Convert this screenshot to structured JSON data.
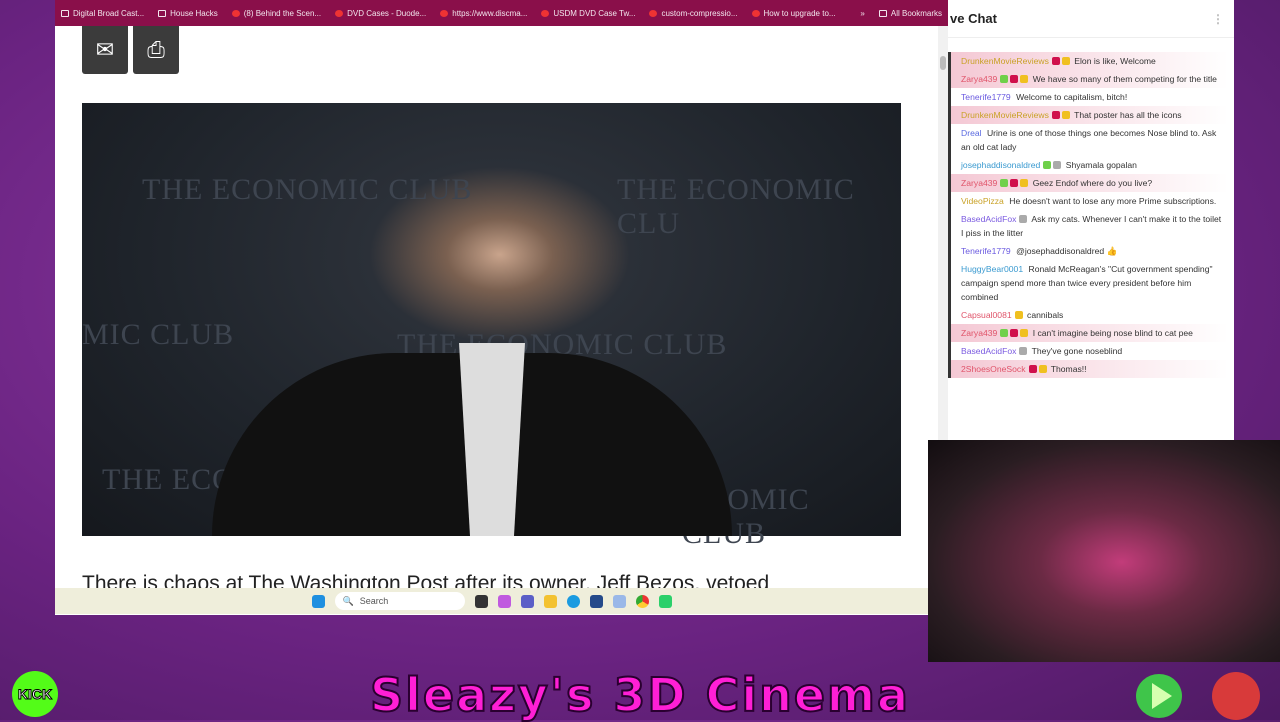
{
  "bookmarks": [
    {
      "label": "Digital Broad Cast...",
      "icon": "folder-icon"
    },
    {
      "label": "House Hacks",
      "icon": "folder-icon"
    },
    {
      "label": "(8) Behind the Scen...",
      "icon": "youtube-icon"
    },
    {
      "label": "DVD Cases - Duode...",
      "icon": "site-icon"
    },
    {
      "label": "https://www.discma...",
      "icon": "site-icon"
    },
    {
      "label": "USDM DVD Case Tw...",
      "icon": "site-icon"
    },
    {
      "label": "custom-compressio...",
      "icon": "wordpress-icon"
    },
    {
      "label": "How to upgrade to...",
      "icon": "apple-icon"
    }
  ],
  "bookmarks_more": "»",
  "all_bookmarks": "All Bookmarks",
  "article": {
    "share": {
      "email_icon": "✉",
      "print_icon": "⎙"
    },
    "photo_text": [
      "THE ECONOMIC CLUB",
      "THE ECONOMIC CLU",
      "MIC CLUB",
      "THE ECONOMIC CLUB",
      "THE ECO",
      "ONOMIC CLUB"
    ],
    "headline": "There is chaos at The Washington Post after its owner, Jeff Bezos, vetoed"
  },
  "taskbar": {
    "search_placeholder": "Search"
  },
  "chat": {
    "title": "ve Chat",
    "menu_icon": "⋮",
    "messages": [
      {
        "user": "DrunkenMovieReviews",
        "color": "#c9a227",
        "text": "Elon is like, Welcome",
        "hl": true,
        "badges": [
          "#d0104c",
          "#f0c020"
        ]
      },
      {
        "user": "Zarya439",
        "color": "#e0546a",
        "text": "We have so many of them competing for the title",
        "hl": true,
        "badges": [
          "#6fd04a",
          "#d0104c",
          "#f0c020"
        ]
      },
      {
        "user": "Tenerife1779",
        "color": "#6a5ae0",
        "text": "Welcome to capitalism, bitch!",
        "hl": false,
        "badges": []
      },
      {
        "user": "DrunkenMovieReviews",
        "color": "#c9a227",
        "text": "That poster has all the icons",
        "hl": true,
        "badges": [
          "#d0104c",
          "#f0c020"
        ]
      },
      {
        "user": "Dreal",
        "color": "#5a6ae0",
        "text": "Urine is one of those things one becomes Nose blind to. Ask an old cat lady",
        "hl": false,
        "badges": []
      },
      {
        "user": "josephaddisonaldred",
        "color": "#3a9ad0",
        "text": "Shyamala gopalan",
        "hl": false,
        "badges": [
          "#6fd04a",
          "#aaaaaa"
        ]
      },
      {
        "user": "Zarya439",
        "color": "#e0546a",
        "text": "Geez Endof where do you live?",
        "hl": true,
        "badges": [
          "#6fd04a",
          "#d0104c",
          "#f0c020"
        ]
      },
      {
        "user": "VideoPizza",
        "color": "#c9a227",
        "text": "He doesn't want to lose any more Prime subscriptions.",
        "hl": false,
        "badges": []
      },
      {
        "user": "BasedAcidFox",
        "color": "#7a5ae0",
        "text": "Ask my cats. Whenever I can't make it to the toilet I piss in the litter",
        "hl": false,
        "badges": [
          "#aaaaaa"
        ]
      },
      {
        "user": "Tenerife1779",
        "color": "#6a5ae0",
        "text": "@josephaddisonaldred 👍",
        "hl": false,
        "badges": []
      },
      {
        "user": "HuggyBear0001",
        "color": "#3a9ad0",
        "text": "Ronald McReagan's \"Cut government spending\" campaign spend more than twice every president before him combined",
        "hl": false,
        "badges": []
      },
      {
        "user": "Capsual0081",
        "color": "#e0546a",
        "text": "cannibals",
        "hl": false,
        "badges": [
          "#f0c020"
        ]
      },
      {
        "user": "Zarya439",
        "color": "#e0546a",
        "text": "I can't imagine being nose blind to cat pee",
        "hl": true,
        "badges": [
          "#6fd04a",
          "#d0104c",
          "#f0c020"
        ]
      },
      {
        "user": "BasedAcidFox",
        "color": "#7a5ae0",
        "text": "They've gone noseblind",
        "hl": false,
        "badges": [
          "#aaaaaa"
        ]
      },
      {
        "user": "2ShoesOneSock",
        "color": "#e0546a",
        "text": "Thomas!!",
        "hl": true,
        "badges": [
          "#d0104c",
          "#f0c020"
        ]
      }
    ]
  },
  "overlay": {
    "title": "Sleazy's 3D Cinema",
    "kick_logo": "KICK"
  },
  "colors": {
    "bookmarks_bar": "#8a0f4a",
    "title": "#ff1fd6",
    "kick": "#53fc18"
  }
}
